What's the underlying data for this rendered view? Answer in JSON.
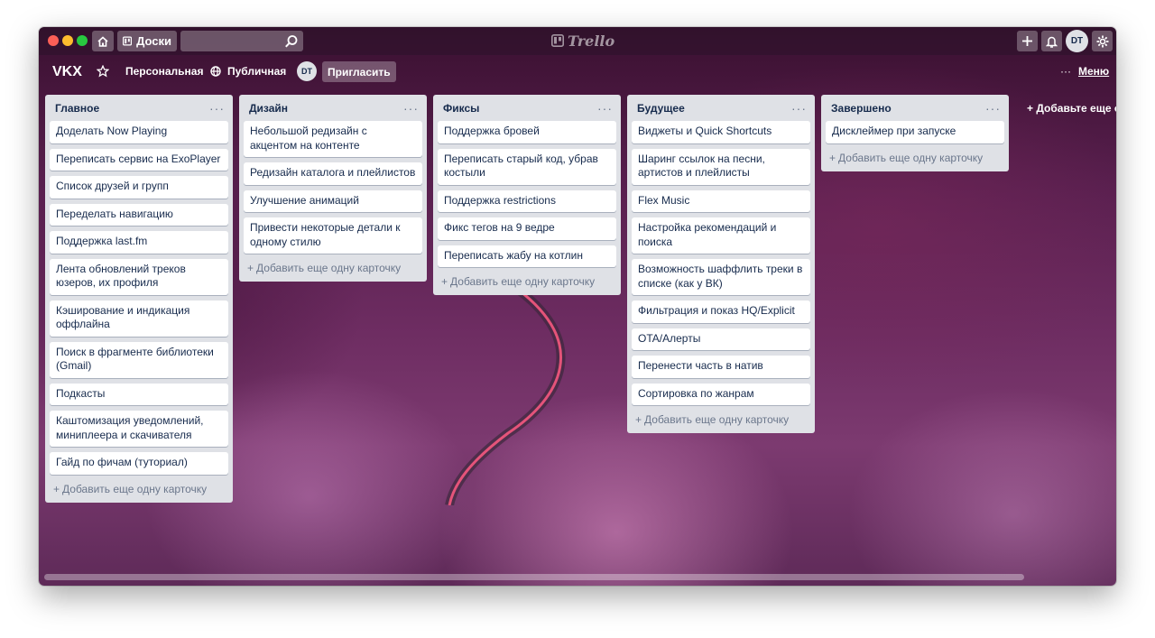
{
  "topbar": {
    "boards_label": "Доски",
    "search_placeholder": "",
    "logo_text": "Trello",
    "avatar_initials": "DT"
  },
  "board": {
    "title": "VKX",
    "visibility_personal": "Персональная",
    "visibility_public": "Публичная",
    "member_initials": "DT",
    "invite_label": "Пригласить",
    "menu_dots": "···",
    "menu_label": "Меню",
    "add_list_label": "+ Добавьте еще од"
  },
  "add_card_label": "Добавить еще одну карточку",
  "list_menu_glyph": "···",
  "lists": [
    {
      "title": "Главное",
      "cards": [
        "Доделать Now Playing",
        "Переписать сервис на ExoPlayer",
        "Список друзей и групп",
        "Переделать навигацию",
        "Поддержка last.fm",
        "Лента обновлений треков юзеров, их профиля",
        "Кэширование и индикация оффлайна",
        "Поиск в фрагменте библиотеки (Gmail)",
        "Подкасты",
        "Каштомизация уведомлений, миниплеера и скачивателя",
        "Гайд по фичам (туториал)"
      ]
    },
    {
      "title": "Дизайн",
      "cards": [
        "Небольшой редизайн с акцентом на контенте",
        "Редизайн каталога и плейлистов",
        "Улучшение анимаций",
        "Привести некоторые детали к одному стилю"
      ]
    },
    {
      "title": "Фиксы",
      "cards": [
        "Поддержка бровей",
        "Переписать старый код, убрав костыли",
        "Поддержка restrictions",
        "Фикс тегов на 9 ведре",
        "Переписать жабу на котлин"
      ]
    },
    {
      "title": "Будущее",
      "cards": [
        "Виджеты и Quick Shortcuts",
        "Шаринг ссылок на песни, артистов и плейлисты",
        "Flex Music",
        "Настройка рекомендаций и поиска",
        "Возможность шаффлить треки в списке (как у ВК)",
        "Фильтрация и показ HQ/Explicit",
        "OTA/Алерты",
        "Перенести часть в натив",
        "Сортировка по жанрам"
      ]
    },
    {
      "title": "Завершено",
      "cards": [
        "Дисклеймер при запуске"
      ]
    }
  ]
}
